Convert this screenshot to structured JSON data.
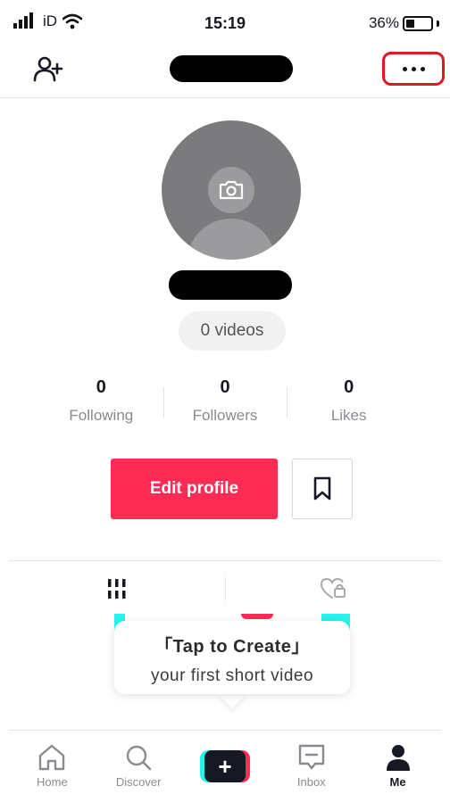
{
  "status_bar": {
    "carrier": "iD",
    "time": "15:19",
    "battery": "36%",
    "battery_level": 0.36
  },
  "header": {
    "add_user_icon": "add-user-icon",
    "menu_icon": "more-horizontal-icon",
    "menu_highlight_color": "#e3151f"
  },
  "profile": {
    "videos_label": "0 videos",
    "avatar_icon": "camera-icon"
  },
  "stats": [
    {
      "number": "0",
      "label": "Following"
    },
    {
      "number": "0",
      "label": "Followers"
    },
    {
      "number": "0",
      "label": "Likes"
    }
  ],
  "actions": {
    "edit_label": "Edit profile",
    "bookmark_icon": "bookmark-icon",
    "accent_color": "#fe2c55"
  },
  "tabs": [
    {
      "icon": "videos-grid-icon"
    },
    {
      "icon": "liked-private-icon"
    }
  ],
  "create_card": {
    "title": "「Tap to Create」",
    "subtitle": "your first short video"
  },
  "bottom_nav": [
    {
      "label": "Home",
      "icon": "home-icon"
    },
    {
      "label": "Discover",
      "icon": "search-icon"
    },
    {
      "label": "",
      "icon": "create-plus-icon"
    },
    {
      "label": "Inbox",
      "icon": "inbox-icon"
    },
    {
      "label": "Me",
      "icon": "profile-icon"
    }
  ]
}
